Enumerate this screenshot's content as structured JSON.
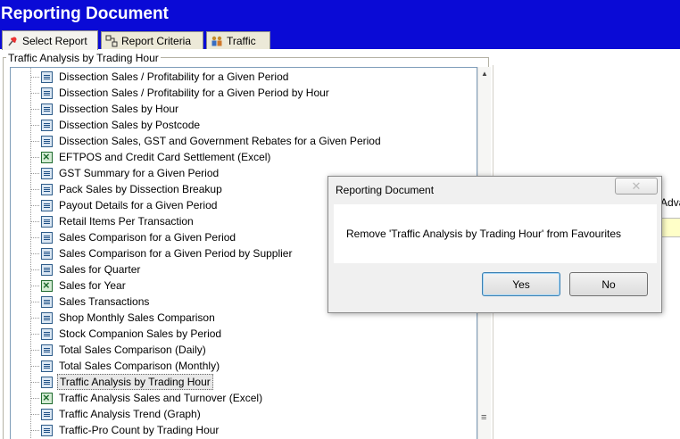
{
  "window": {
    "title": "Reporting Document"
  },
  "tabs": [
    {
      "label": "Select Report",
      "icon": "pin-icon"
    },
    {
      "label": "Report Criteria",
      "icon": "criteria-icon"
    },
    {
      "label": "Traffic",
      "icon": "people-icon"
    }
  ],
  "group": {
    "label": "Traffic Analysis by Trading Hour"
  },
  "reports": [
    {
      "label": "Dissection Sales / Profitability for a Given Period",
      "type": "doc"
    },
    {
      "label": "Dissection Sales / Profitability for a Given Period by Hour",
      "type": "doc"
    },
    {
      "label": "Dissection Sales by Hour",
      "type": "doc"
    },
    {
      "label": "Dissection Sales by Postcode",
      "type": "doc"
    },
    {
      "label": "Dissection Sales, GST and Government Rebates for a Given Period",
      "type": "doc"
    },
    {
      "label": "EFTPOS and Credit Card Settlement (Excel)",
      "type": "excel"
    },
    {
      "label": "GST Summary for a Given Period",
      "type": "doc"
    },
    {
      "label": "Pack Sales by Dissection Breakup",
      "type": "doc"
    },
    {
      "label": "Payout Details for a Given Period",
      "type": "doc"
    },
    {
      "label": "Retail Items Per Transaction",
      "type": "doc"
    },
    {
      "label": "Sales Comparison for a Given Period",
      "type": "doc"
    },
    {
      "label": "Sales Comparison for a Given Period by Supplier",
      "type": "doc"
    },
    {
      "label": "Sales for Quarter",
      "type": "doc"
    },
    {
      "label": "Sales for Year",
      "type": "excel"
    },
    {
      "label": "Sales Transactions",
      "type": "doc"
    },
    {
      "label": "Shop Monthly Sales Comparison",
      "type": "doc"
    },
    {
      "label": "Stock Companion Sales by Period",
      "type": "doc"
    },
    {
      "label": "Total Sales Comparison (Daily)",
      "type": "doc"
    },
    {
      "label": "Total Sales Comparison (Monthly)",
      "type": "doc"
    },
    {
      "label": "Traffic Analysis by Trading Hour",
      "type": "doc",
      "selected": true
    },
    {
      "label": "Traffic Analysis Sales and Turnover (Excel)",
      "type": "excel"
    },
    {
      "label": "Traffic Analysis Trend (Graph)",
      "type": "doc"
    },
    {
      "label": "Traffic-Pro Count by Trading Hour",
      "type": "doc"
    }
  ],
  "right_pane": {
    "partial_label": "Adva"
  },
  "dialog": {
    "title": "Reporting Document",
    "close_label": "✕",
    "message": "Remove 'Traffic Analysis by Trading Hour' from Favourites",
    "yes_label": "Yes",
    "no_label": "No"
  }
}
